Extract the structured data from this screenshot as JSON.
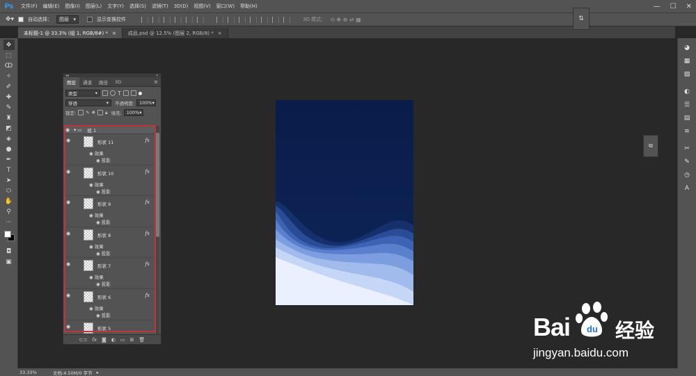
{
  "app": {
    "logo": "Ps"
  },
  "menu": [
    "文件(F)",
    "编辑(E)",
    "图像(I)",
    "图层(L)",
    "文字(Y)",
    "选择(S)",
    "滤镜(T)",
    "3D(D)",
    "视图(V)",
    "窗口(W)",
    "帮助(H)"
  ],
  "window_controls": {
    "minimize": "—",
    "maximize": "☐",
    "close": "✕"
  },
  "options": {
    "auto_select_label": "自动选择：",
    "auto_select_value": "图层",
    "show_transform_label": "显示变换控件",
    "mode_3d_label": "3D 模式："
  },
  "tabs": [
    {
      "label": "未标题-1 @ 33.3% (组 1, RGB/8#) *",
      "close": "×",
      "active": true
    },
    {
      "label": "成品.psd @ 12.5% (图层 2, RGB/8) *",
      "close": "×",
      "active": false
    }
  ],
  "layers_panel": {
    "tabs": [
      "图层",
      "通道",
      "路径",
      "3D"
    ],
    "filter_kind": "类型",
    "blend_mode": "穿透",
    "opacity_label": "不透明度:",
    "opacity_value": "100%",
    "lock_label": "锁定:",
    "fill_label": "填充:",
    "fill_value": "100%",
    "group_name": "组 1",
    "effects_label": "效果",
    "shadow_label": "投影",
    "fx_label": "fx",
    "layers": [
      {
        "name": "形状 11"
      },
      {
        "name": "形状 10"
      },
      {
        "name": "形状 9"
      },
      {
        "name": "形状 8"
      },
      {
        "name": "形状 7"
      },
      {
        "name": "形状 6"
      },
      {
        "name": "形状 5"
      }
    ]
  },
  "status": {
    "zoom": "33.33%",
    "doc_info": "文档:4.50M/0 字节"
  },
  "canvas_colors": {
    "top": "#0b1f4d",
    "wave_dark": "#1c3b80",
    "wave_mid": "#4a74c5",
    "wave_light": "#a6c0ee",
    "bottom": "#eef3ff"
  },
  "watermark": {
    "bai": "Bai",
    "jingyan": "经验",
    "url": "jingyan.baidu.com"
  }
}
